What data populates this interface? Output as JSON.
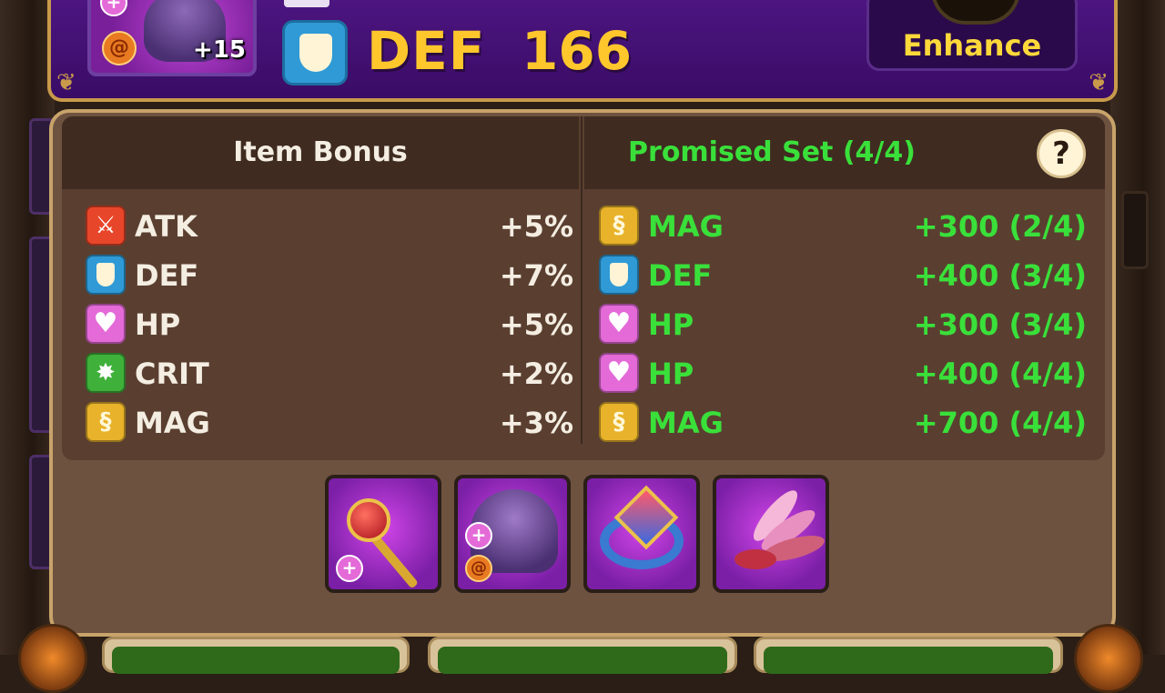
{
  "header": {
    "item_level": "+15",
    "stat_name": "DEF",
    "stat_value": "166",
    "enhance_label": "Enhance"
  },
  "item_bonus": {
    "title": "Item Bonus",
    "rows": [
      {
        "icon": "atk-icon",
        "name": "ATK",
        "value": "+5%"
      },
      {
        "icon": "def-icon",
        "name": "DEF",
        "value": "+7%"
      },
      {
        "icon": "hp-icon",
        "name": "HP",
        "value": "+5%"
      },
      {
        "icon": "crit-icon",
        "name": "CRIT",
        "value": "+2%"
      },
      {
        "icon": "mag-icon",
        "name": "MAG",
        "value": "+3%"
      }
    ]
  },
  "set_bonus": {
    "title": "Promised Set (4/4)",
    "help_label": "?",
    "rows": [
      {
        "icon": "mag-icon",
        "name": "MAG",
        "value": "+300 (2/4)"
      },
      {
        "icon": "def-icon",
        "name": "DEF",
        "value": "+400 (3/4)"
      },
      {
        "icon": "hp-icon",
        "name": "HP",
        "value": "+300 (3/4)"
      },
      {
        "icon": "hp-icon",
        "name": "HP",
        "value": "+400 (4/4)"
      },
      {
        "icon": "mag-icon",
        "name": "MAG",
        "value": "+700 (4/4)"
      }
    ]
  },
  "set_items": [
    {
      "name": "scepter",
      "badge": "+"
    },
    {
      "name": "hood",
      "badge": "+"
    },
    {
      "name": "ring",
      "badge": ""
    },
    {
      "name": "wings",
      "badge": ""
    }
  ],
  "colors": {
    "accent_gold": "#ffc72c",
    "set_green": "#3ae03a",
    "banner_purple": "#4c1580",
    "panel_brown": "#6e5240"
  }
}
